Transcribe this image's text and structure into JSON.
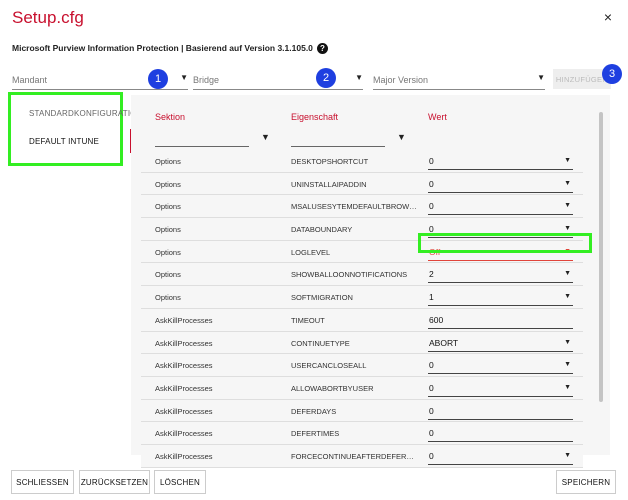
{
  "window": {
    "title": "Setup.cfg",
    "close_label": "×"
  },
  "subtitle": "Microsoft Purview Information Protection | Basierend auf Version 3.1.105.0",
  "help_label": "?",
  "filters": {
    "mandant": "Mandant",
    "bridge": "Bridge",
    "major_version": "Major Version",
    "add_button": "HINZUFÜGEN"
  },
  "badges": [
    "1",
    "2",
    "3"
  ],
  "sidebar": {
    "items": [
      {
        "label": "STANDARDKONFIGURATION"
      },
      {
        "label": "DEFAULT INTUNE"
      }
    ]
  },
  "table": {
    "columns": [
      "Sektion",
      "Eigenschaft",
      "Wert"
    ],
    "rows": [
      {
        "section": "Options",
        "property": "DESKTOPSHORTCUT",
        "value": "0",
        "dropdown": true
      },
      {
        "section": "Options",
        "property": "UNINSTALLAIPADDIN",
        "value": "0",
        "dropdown": true
      },
      {
        "section": "Options",
        "property": "MSALUSESYTEMDEFAULTBROW…",
        "value": "0",
        "dropdown": true
      },
      {
        "section": "Options",
        "property": "DATABOUNDARY",
        "value": "0",
        "dropdown": true
      },
      {
        "section": "Options",
        "property": "LOGLEVEL",
        "value": "Off",
        "dropdown": true,
        "highlighted": true
      },
      {
        "section": "Options",
        "property": "SHOWBALLOONNOTIFICATIONS",
        "value": "2",
        "dropdown": true
      },
      {
        "section": "Options",
        "property": "SOFTMIGRATION",
        "value": "1",
        "dropdown": true
      },
      {
        "section": "AskKillProcesses",
        "property": "TIMEOUT",
        "value": "600",
        "dropdown": false
      },
      {
        "section": "AskKillProcesses",
        "property": "CONTINUETYPE",
        "value": "ABORT",
        "dropdown": true
      },
      {
        "section": "AskKillProcesses",
        "property": "USERCANCLOSEALL",
        "value": "0",
        "dropdown": true
      },
      {
        "section": "AskKillProcesses",
        "property": "ALLOWABORTBYUSER",
        "value": "0",
        "dropdown": true
      },
      {
        "section": "AskKillProcesses",
        "property": "DEFERDAYS",
        "value": "0",
        "dropdown": false
      },
      {
        "section": "AskKillProcesses",
        "property": "DEFERTIMES",
        "value": "0",
        "dropdown": false
      },
      {
        "section": "AskKillProcesses",
        "property": "FORCECONTINUEAFTERDEFER…",
        "value": "0",
        "dropdown": true
      }
    ]
  },
  "footer": {
    "close": "SCHLIESSEN",
    "reset": "ZURÜCKSETZEN",
    "delete": "LÖSCHEN",
    "save": "SPEICHERN"
  },
  "colors": {
    "accent": "#c8102e",
    "badge": "#1e3fe0",
    "highlight_box": "#33ee22",
    "highlight_value": "#e0443a"
  }
}
